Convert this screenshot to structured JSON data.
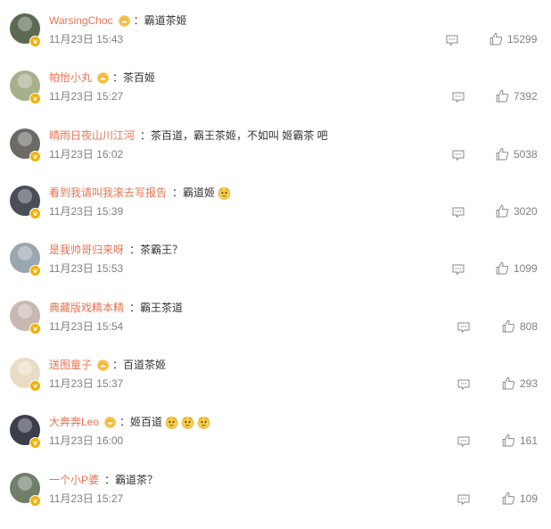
{
  "comments": [
    {
      "username": "WarsingChoc",
      "crown": true,
      "text": "：霸道茶姬",
      "emojis": 0,
      "time": "11月23日 15:43",
      "likes": "15299",
      "avatar_color": "#5b6b52"
    },
    {
      "username": "帕怡小丸",
      "crown": true,
      "text": "：茶百姬",
      "emojis": 0,
      "time": "11月23日 15:27",
      "likes": "7392",
      "avatar_color": "#a7b08c"
    },
    {
      "username": "晴雨日夜山川江河",
      "crown": false,
      "text": "：茶百道，霸王茶姬，不如叫 姬霸茶 吧",
      "emojis": 0,
      "time": "11月23日 16:02",
      "likes": "5038",
      "avatar_color": "#6d6a66"
    },
    {
      "username": "看到我请叫我滚去写报告",
      "crown": false,
      "text": "：霸道姬",
      "emojis": 1,
      "time": "11月23日 15:39",
      "likes": "3020",
      "avatar_color": "#4a4e57"
    },
    {
      "username": "是我帅哥归来呀",
      "crown": false,
      "text": "：茶霸王？",
      "emojis": 0,
      "time": "11月23日 15:53",
      "likes": "1099",
      "avatar_color": "#9aa6b0"
    },
    {
      "username": "典藏版戏精本精",
      "crown": false,
      "text": "：霸王茶道",
      "emojis": 0,
      "time": "11月23日 15:54",
      "likes": "808",
      "avatar_color": "#c9b8b2"
    },
    {
      "username": "送图童子",
      "crown": true,
      "text": "：百道茶姬",
      "emojis": 0,
      "time": "11月23日 15:37",
      "likes": "293",
      "avatar_color": "#e8dcc4"
    },
    {
      "username": "大奔奔Leo",
      "crown": true,
      "text": "：姬百道",
      "emojis": 3,
      "time": "11月23日 16:00",
      "likes": "161",
      "avatar_color": "#3b3f4c"
    },
    {
      "username": "一个小P婆",
      "crown": false,
      "text": "：霸道茶？",
      "emojis": 0,
      "time": "11月23日 15:27",
      "likes": "109",
      "avatar_color": "#6f7f6a"
    }
  ]
}
